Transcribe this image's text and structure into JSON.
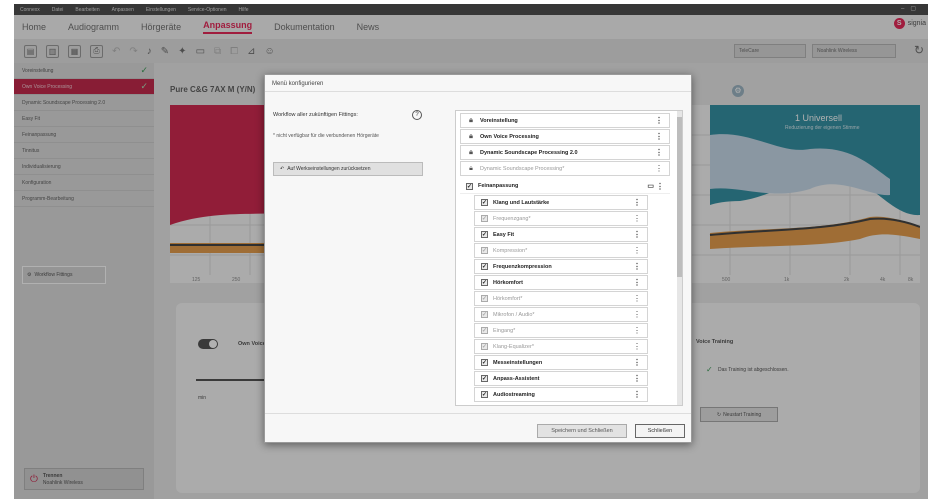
{
  "titlebar": {
    "items": [
      "Connexx",
      "Datei",
      "Bearbeiten",
      "Anpassen",
      "Einstellungen",
      "Service-Optionen",
      "Hilfe"
    ]
  },
  "menu": {
    "tabs": [
      {
        "label": "Home"
      },
      {
        "label": "Audiogramm"
      },
      {
        "label": "Hörgeräte"
      },
      {
        "label": "Anpassung",
        "active": true
      },
      {
        "label": "Dokumentation"
      },
      {
        "label": "News"
      }
    ],
    "brand": "signia",
    "brand_mark": "S"
  },
  "toolbar": {
    "select_1": "TeleCare",
    "select_2": "Noahlink Wireless"
  },
  "sidebar": {
    "items": [
      {
        "label": "Voreinstellung",
        "done": true
      },
      {
        "label": "Own Voice Processing",
        "active": true,
        "done": true
      },
      {
        "label": "Dynamic Soundscape Processing 2.0"
      },
      {
        "label": "Easy Fit"
      },
      {
        "label": "Feinanpassung"
      },
      {
        "label": "Tinnitus"
      },
      {
        "label": "Individualisierung"
      },
      {
        "label": "Konfiguration"
      },
      {
        "label": "Programm-Bearbeitung"
      }
    ],
    "workflow_button": "Workflow Fittings",
    "trennen_title": "Trennen",
    "trennen_sub": "Noahlink Wireless"
  },
  "main": {
    "device_title": "Pure C&G 7AX M (Y/N)",
    "program_label": "1 Universell",
    "program_sub": "Reduzierung der eigenen Stimme",
    "x_ticks_left": [
      "125",
      "250"
    ],
    "x_ticks_right": [
      "500",
      "1k",
      "2k",
      "4k",
      "8k"
    ],
    "own_voice_label": "Own Voice Pr...",
    "ovp_training_label": "Voice Training",
    "training_done": "Das Training ist abgeschlossen.",
    "restart_training": "Neustart Training",
    "slider_label": "min"
  },
  "modal": {
    "title": "Menü konfigurieren",
    "workflow_label": "Workflow aller zukünftigen Fittings:",
    "note": "* nicht verfügbar für die verbundenen Hörgeräte",
    "reset_button": "Auf Werkseinstellungen zurücksetzen",
    "items": [
      {
        "label": "Voreinstellung",
        "type": "locked",
        "dim": false
      },
      {
        "label": "Own Voice Processing",
        "type": "locked",
        "dim": false
      },
      {
        "label": "Dynamic Soundscape Processing 2.0",
        "type": "locked",
        "dim": false
      },
      {
        "label": "Dynamic Soundscape Processing*",
        "type": "locked",
        "dim": true
      },
      {
        "label": "Feinanpassung",
        "type": "group",
        "dim": false
      },
      {
        "label": "Klang und Lautstärke",
        "type": "child",
        "dim": false
      },
      {
        "label": "Frequenzgang*",
        "type": "child",
        "dim": true
      },
      {
        "label": "Easy Fit",
        "type": "child",
        "dim": false
      },
      {
        "label": "Kompression*",
        "type": "child",
        "dim": true
      },
      {
        "label": "Frequenzkompression",
        "type": "child",
        "dim": false
      },
      {
        "label": "Hörkomfort",
        "type": "child",
        "dim": false
      },
      {
        "label": "Hörkomfort*",
        "type": "child",
        "dim": true
      },
      {
        "label": "Mikrofon / Audio*",
        "type": "child",
        "dim": true
      },
      {
        "label": "Eingang*",
        "type": "child",
        "dim": true
      },
      {
        "label": "Klang-Equalizer*",
        "type": "child",
        "dim": true
      },
      {
        "label": "Messeinstellungen",
        "type": "child",
        "dim": false
      },
      {
        "label": "Anpass-Assistent",
        "type": "child",
        "dim": false
      },
      {
        "label": "Audiostreaming",
        "type": "child",
        "dim": false
      }
    ],
    "save_button": "Speichern und Schließen",
    "close_button": "Schließen"
  },
  "colors": {
    "accent": "#e2003a",
    "left_curve": "#c8002f",
    "right_curve": "#0e7d93",
    "output_band": "#e08a2a",
    "check": "#1a8a3a"
  }
}
